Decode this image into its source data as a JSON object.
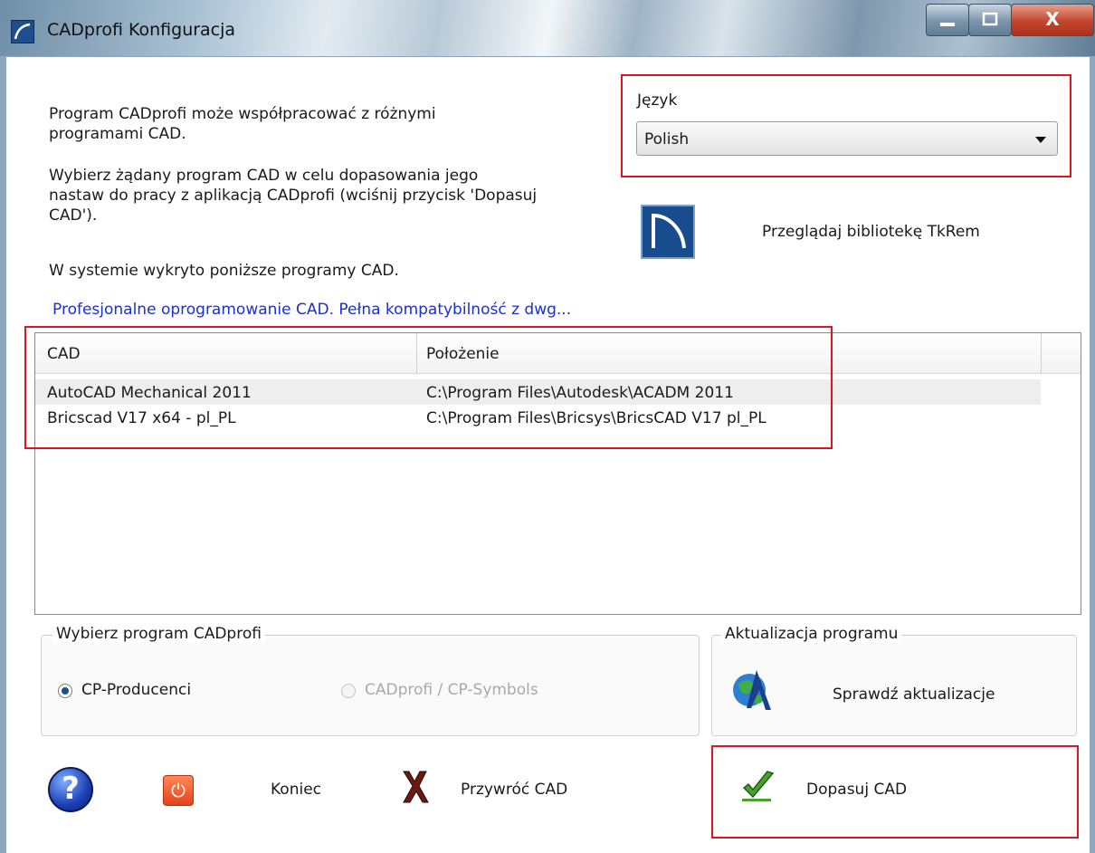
{
  "window": {
    "title": "CADprofi Konfiguracja",
    "close_glyph": "X"
  },
  "intro": {
    "line1": "Program CADprofi może współpracować z różnymi",
    "line2": "programami CAD.",
    "line3": "Wybierz żądany program CAD w celu dopasowania jego",
    "line4": "nastaw do pracy z aplikacją CADprofi (wciśnij przycisk 'Dopasuj",
    "line5": "CAD').",
    "line6": "W systemie wykryto poniższe programy CAD."
  },
  "link": "Profesjonalne oprogramowanie CAD. Pełna kompatybilność z dwg...",
  "language": {
    "label": "Język",
    "selected": "Polish"
  },
  "tkrem": {
    "label": "Przeglądaj bibliotekę TkRem",
    "icon": "tkrem-library-icon"
  },
  "cad_list": {
    "columns": [
      "CAD",
      "Położenie"
    ],
    "rows": [
      {
        "cad": "AutoCAD Mechanical 2011",
        "path": "C:\\Program Files\\Autodesk\\ACADM 2011"
      },
      {
        "cad": "Bricscad V17 x64 - pl_PL",
        "path": "C:\\Program Files\\Bricsys\\BricsCAD V17 pl_PL"
      }
    ]
  },
  "choose_program": {
    "legend": "Wybierz program CADprofi",
    "options": [
      {
        "label": "CP-Producenci",
        "checked": true,
        "enabled": true
      },
      {
        "label": "CADprofi / CP-Symbols",
        "checked": false,
        "enabled": false
      }
    ]
  },
  "update": {
    "legend": "Aktualizacja programu",
    "label": "Sprawdź aktualizacje",
    "icon": "globe-update-icon"
  },
  "bottom": {
    "help_glyph": "?",
    "power_glyph": "⏻",
    "koniec": "Koniec",
    "restore": "Przywróć CAD",
    "adapt": "Dopasuj CAD"
  },
  "colors": {
    "highlight_red": "#e0141e",
    "link_blue": "#1a2fd6",
    "icon_blue": "#1f4e8f"
  }
}
